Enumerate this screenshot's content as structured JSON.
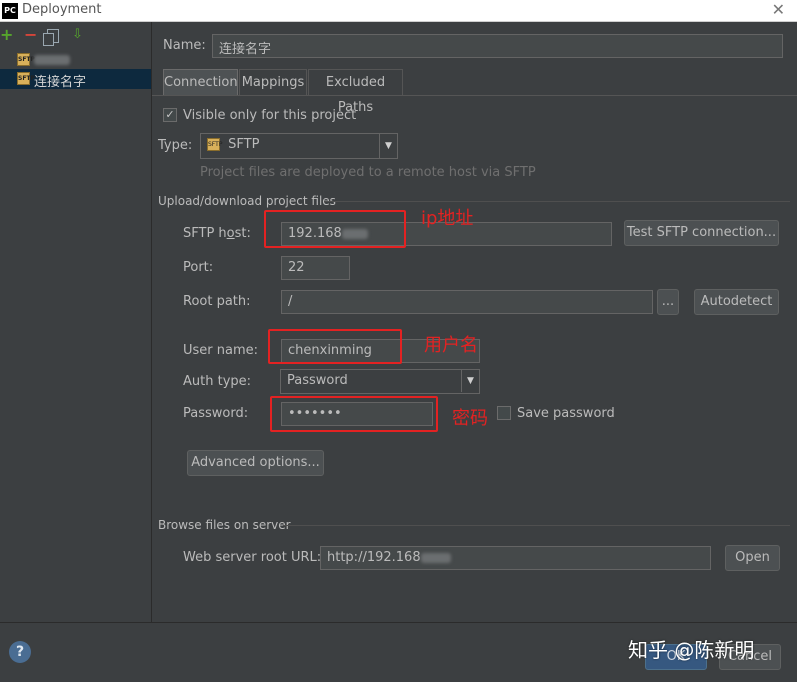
{
  "window": {
    "title": "Deployment",
    "app_icon": "PC"
  },
  "left": {
    "servers": [
      {
        "label": ""
      },
      {
        "label": "连接名字"
      }
    ]
  },
  "form": {
    "name_label": "Name:",
    "name_value": "连接名字",
    "tabs": [
      "Connection",
      "Mappings",
      "Excluded Paths"
    ],
    "visible_only_label": "Visible only for this project",
    "type_label": "Type:",
    "type_value": "SFTP",
    "type_hint": "Project files are deployed to a remote host via SFTP",
    "upload_section": "Upload/download project files",
    "sftp_host_label": "SFTP host:",
    "sftp_host_value": "192.168",
    "test_button": "Test SFTP connection...",
    "port_label": "Port:",
    "port_value": "22",
    "root_path_label": "Root path:",
    "root_path_value": "/",
    "browse_button": "...",
    "autodetect_button": "Autodetect",
    "user_name_label": "User name:",
    "user_name_value": "chenxinming",
    "auth_type_label": "Auth type:",
    "auth_type_value": "Password",
    "password_label": "Password:",
    "password_value": "•••••••",
    "save_password_label": "Save password",
    "advanced_button": "Advanced options...",
    "browse_section": "Browse files on server",
    "web_root_label": "Web server root URL:",
    "web_root_value": "http://192.168",
    "open_button": "Open"
  },
  "annotations": {
    "ip": "ip地址",
    "user": "用户名",
    "password": "密码"
  },
  "footer": {
    "help": "?",
    "ok": "OK",
    "cancel": "Cancel",
    "watermark": "知乎 @陈新明"
  },
  "colors": {
    "background": "#3c3f41",
    "annotation_red": "#e32222",
    "selection": "#0d293e"
  }
}
